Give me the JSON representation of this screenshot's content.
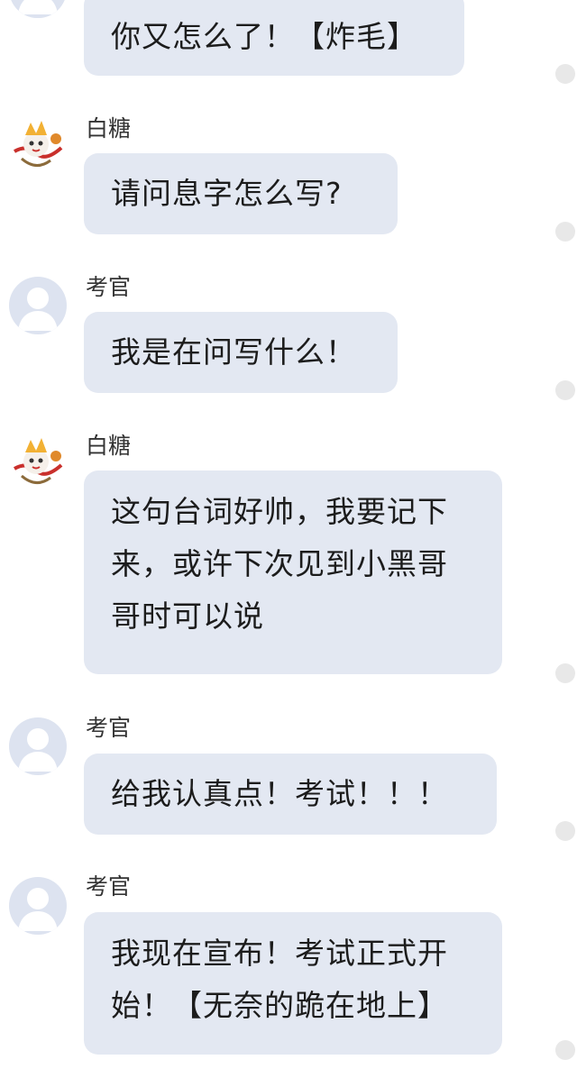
{
  "messages": [
    {
      "sender": "",
      "avatar": "none",
      "text": "你又怎么了！【炸毛】"
    },
    {
      "sender": "白糖",
      "avatar": "cartoon",
      "text": "请问息字怎么写?"
    },
    {
      "sender": "考官",
      "avatar": "default",
      "text": "我是在问写什么！"
    },
    {
      "sender": "白糖",
      "avatar": "cartoon",
      "text": "这句台词好帅，我要记下来，或许下次见到小黑哥哥时可以说"
    },
    {
      "sender": "考官",
      "avatar": "default",
      "text": "给我认真点！考试！！！"
    },
    {
      "sender": "考官",
      "avatar": "default",
      "text": "我现在宣布！考试正式开始！【无奈的跪在地上】"
    }
  ],
  "colors": {
    "bubble": "#e3e8f2",
    "default_avatar_bg": "#dde3f0",
    "default_avatar_fg": "#ffffff",
    "read_dot": "#e8e8e8"
  }
}
